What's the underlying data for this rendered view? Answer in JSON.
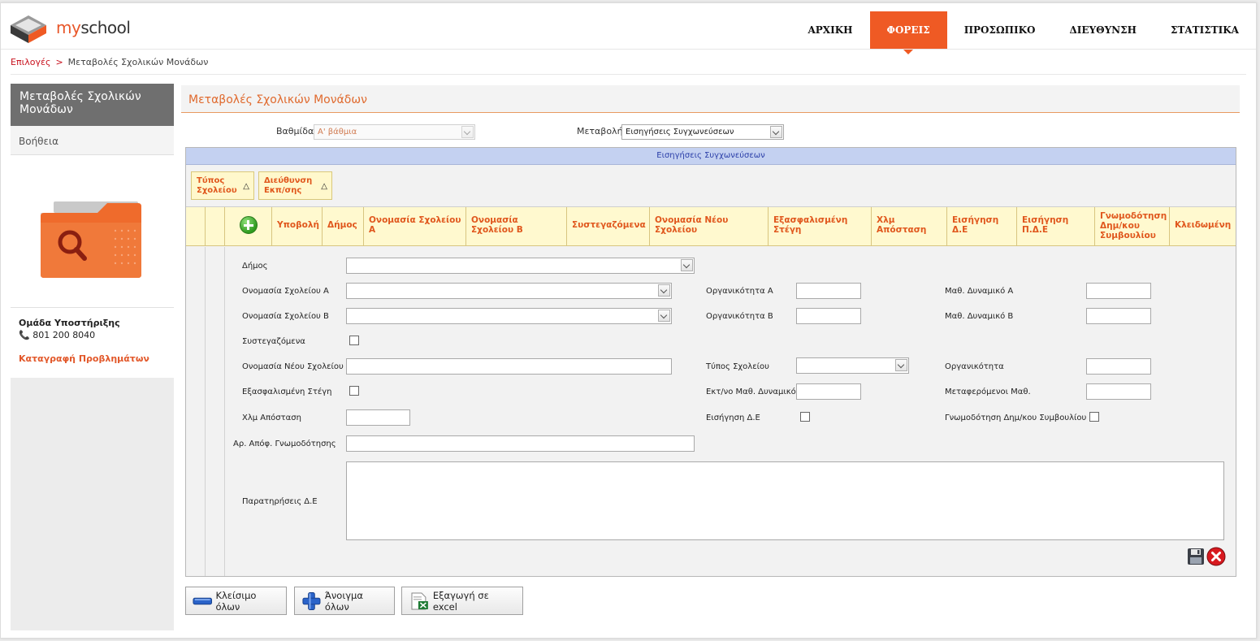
{
  "header": {
    "logo_text_prefix": "my",
    "logo_text_suffix": "school",
    "nav": [
      {
        "label": "ΑΡΧΙΚΗ",
        "active": false
      },
      {
        "label": "ΦΟΡΕΙΣ",
        "active": true
      },
      {
        "label": "ΠΡΟΣΩΠΙΚΟ",
        "active": false
      },
      {
        "label": "ΔΙΕΥΘΥΝΣΗ",
        "active": false
      },
      {
        "label": "ΣΤΑΤΙΣΤΙΚΑ",
        "active": false
      }
    ]
  },
  "breadcrumb": {
    "root": "Επιλογές",
    "separator": ">",
    "current": "Μεταβολές Σχολικών Μονάδων"
  },
  "sidebar": {
    "title": "Μεταβολές Σχολικών Μονάδων",
    "help": "Βοήθεια",
    "image_icon": "folder-search-icon",
    "support_title": "Ομάδα Υποστήριξης",
    "support_phone": "801 200 8040",
    "support_link": "Καταγραφή Προβλημάτων"
  },
  "main": {
    "title": "Μεταβολές Σχολικών Μονάδων",
    "filters": {
      "level_label": "Βαθμίδα",
      "level_value": "Α' βάθμια",
      "change_label": "Μεταβολή",
      "change_value": "Εισηγήσεις Συγχωνεύσεων"
    },
    "grid": {
      "caption": "Εισηγήσεις Συγχωνεύσεων",
      "group_chips": [
        "Τύπος Σχολείου",
        "Διεύθυνση Εκπ/σης"
      ],
      "columns": [
        "Υποβολή",
        "Δήμος",
        "Ονομασία Σχολείου Α",
        "Ονομασία Σχολείου Β",
        "Συστεγαζόμενα",
        "Ονομασία Νέου Σχολείου",
        "Εξασφαλισμένη Στέγη",
        "Χλμ Απόσταση",
        "Εισήγηση Δ.Ε",
        "Εισήγηση Π.Δ.Ε",
        "Γνωμοδότηση Δημ/κου Συμβουλίου",
        "Κλειδωμένη"
      ]
    },
    "form": {
      "dimos": "Δήμος",
      "school_a": "Ονομασία Σχολείου Α",
      "school_b": "Ονομασία Σχολείου Β",
      "co_housed": "Συστεγαζόμενα",
      "new_school": "Ονομασία Νέου Σχολείου",
      "secured_housing": "Εξασφαλισμένη Στέγη",
      "distance": "Χλμ Απόσταση",
      "opinion_no": "Αρ. Απόφ. Γνωμοδότησης",
      "remarks": "Παρατηρήσεις Δ.Ε",
      "capacity_a": "Οργανικότητα Α",
      "capacity_b": "Οργανικότητα Β",
      "school_type": "Τύπος Σχολείου",
      "est_students": "Εκτ/νο Μαθ. Δυναμικό",
      "proposal_de": "Εισήγηση Δ.Ε",
      "students_a": "Μαθ. Δυναμικό Α",
      "students_b": "Μαθ. Δυναμικό Β",
      "capacity": "Οργανικότητα",
      "transferred": "Μεταφερόμενοι Μαθ.",
      "council_opinion": "Γνωμοδότηση Δημ/κου Συμβουλίου"
    }
  },
  "buttons": {
    "collapse_all": "Κλείσιμο όλων",
    "expand_all": "Άνοιγμα όλων",
    "export_excel": "Εξαγωγή σε excel"
  },
  "colors": {
    "accent": "#ef5a24",
    "link_red": "#c8101c",
    "header_text": "#e0571d",
    "grid_caption_bg": "#c4d1f1"
  }
}
